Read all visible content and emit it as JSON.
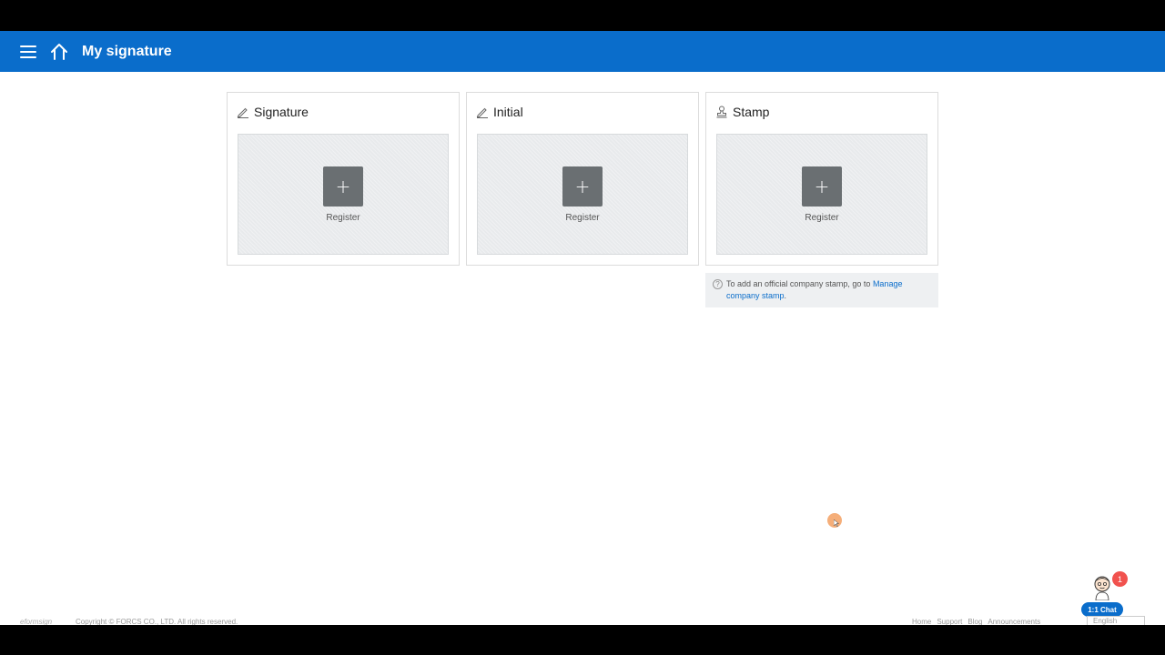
{
  "header": {
    "title": "My signature",
    "color": "#0a6dcb"
  },
  "cards": [
    {
      "title": "Signature",
      "icon": "pen-icon",
      "button_label": "Register"
    },
    {
      "title": "Initial",
      "icon": "pen-icon",
      "button_label": "Register"
    },
    {
      "title": "Stamp",
      "icon": "stamp-icon",
      "button_label": "Register"
    }
  ],
  "stamp_note": {
    "text": "To add an official company stamp, go to ",
    "link": "Manage company stamp",
    "suffix": "."
  },
  "chat": {
    "label": "1:1 Chat",
    "badge_count": "1"
  },
  "footer": {
    "brand": "eformsign",
    "copyright": "Copyright © FORCS CO., LTD. All rights reserved.",
    "links": [
      "Home",
      "Support",
      "Blog",
      "Announcements"
    ],
    "language": "English"
  }
}
